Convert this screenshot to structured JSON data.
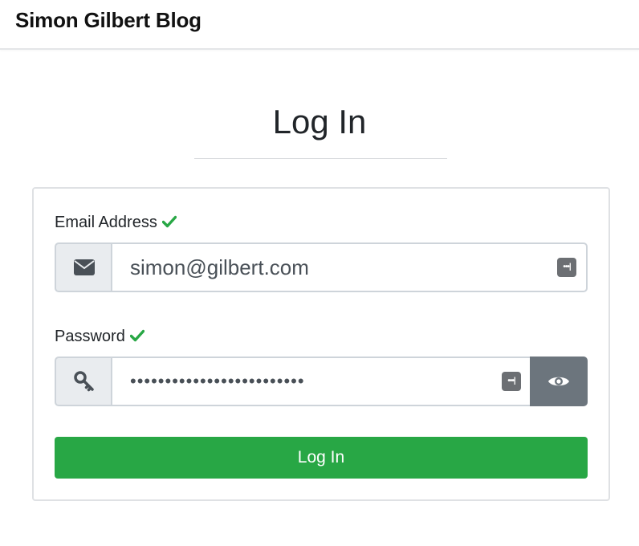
{
  "navbar": {
    "brand": "Simon Gilbert Blog"
  },
  "page": {
    "title": "Log In"
  },
  "form": {
    "email": {
      "label": "Email Address",
      "value": "simon@gilbert.com",
      "icon": "envelope-icon",
      "valid": true
    },
    "password": {
      "label": "Password",
      "value": "•••••••••••••••••••••••••",
      "icon": "key-icon",
      "valid": true
    },
    "submit_label": "Log In"
  },
  "colors": {
    "success": "#28a745",
    "addon_bg": "#e9ecef",
    "toggle_bg": "#6c757d",
    "border": "#ced4da"
  }
}
